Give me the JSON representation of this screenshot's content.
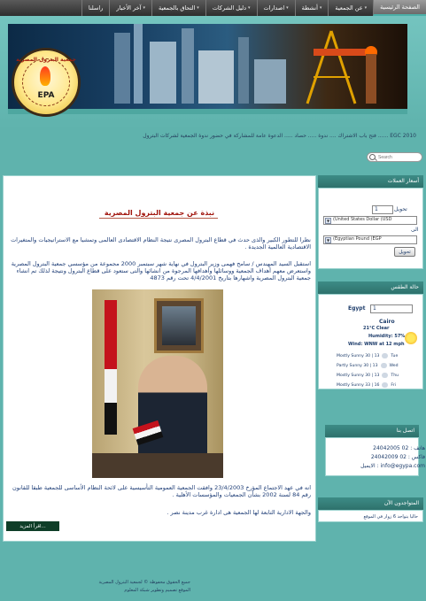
{
  "nav": {
    "items": [
      {
        "label": "الصفحة الرئيسية",
        "arrow": false,
        "active": true
      },
      {
        "label": "عن الجمعية",
        "arrow": true
      },
      {
        "label": "أنشطة",
        "arrow": true
      },
      {
        "label": "اصدارات",
        "arrow": true
      },
      {
        "label": "دليل الشركات",
        "arrow": true
      },
      {
        "label": "التحاق بالجمعية",
        "arrow": true
      },
      {
        "label": "آخر الأخبار",
        "arrow": true
      },
      {
        "label": "راسلنا",
        "arrow": false
      }
    ]
  },
  "header": {
    "logo_arc_text": "جمعية البترول المصرية",
    "logo_text": "EPA",
    "ticker": "EGC 2010 ...... فتح باب الاشتراك ....  ندوة ..... حصاد ..... الدعوة عامة للمشاركة في حضور ندوة الجمعية لشركات البترول"
  },
  "search": {
    "placeholder": "Search"
  },
  "article": {
    "title": "نبذة عن جمعية البترول المصرية",
    "para1": "نظرا للتطور الكبير والذى حدث في قطاع البترول المصرى نتيجة النظام الاقتصادى العالمى وتمشيا مع الاستراتيجيات والمتغيرات الاقتصادية العالمية الجديدة .",
    "para2": "استقبل السيد المهندس / سامح فهمى وزير البترول في نهاية شهر سبتمبر 2000 مجموعة من مؤسسي جمعية البترول المصرية واستعرض معهم أهداف الجمعية ووسائلها وأهدافها المرجوة من انشائها والتى ستعود على قطاع البترول ونتيجة لذلك تم انشاء جمعية البترول المصرية واشهارها بتاريخ 4/4/2001 تحت رقم 4873",
    "para3": "انه في عهد الاجتماع المؤرخ 23/4/2003 وافقت الجمعية العمومية التأسيسية على لائحة النظام الأساسى للجمعية طبقا للقانون رقم 84 لسنة 2002 بشأن الجمعيات والمؤسسات الأهلية .",
    "para4": "والجهة الادارية التابعة لها الجمعية هى ادارة غرب مدينة نصر .",
    "readmore": "اقرأ المزيد..."
  },
  "currency": {
    "header": "أسعار العملات",
    "amount_label": "تحويل",
    "amount_value": "1",
    "to_label": "الى",
    "from_currency": "(United States Dollar (USD",
    "to_currency": "(Egyptian Pound (EGP",
    "convert_button": "تحويل"
  },
  "weather": {
    "header": "حالة الطقس",
    "city_label": "Egypt",
    "city_value": "1",
    "city": "Cairo",
    "temp": "21°C  Clear",
    "humidity": "Humidity: 57%",
    "wind": "Wind: WNW at 12 mph",
    "forecast": [
      {
        "desc": "Mostly Sunny 30 | 13",
        "day": "Tue"
      },
      {
        "desc": "Partly Sunny 30 | 13",
        "day": "Wed"
      },
      {
        "desc": "Mostly Sunny 30 | 13",
        "day": "Thu"
      },
      {
        "desc": "Mostly Sunny 33 | 16",
        "day": "Fri"
      }
    ]
  },
  "contact": {
    "header": "اتصل بنا",
    "phone": "هاتف : 02 24042005",
    "fax": "فاكس : 02 24042009",
    "email": "info@egypa.com : الايميل"
  },
  "online": {
    "header": "المتواجدون الآن",
    "text": "حاليا يتواجد 6 زوار في الموقع"
  },
  "footer": {
    "line1": "جميع الحقوق محفوظة © لجمعية البترول المصرية",
    "line2": "الموقع تصميم وتطوير شبكة المعلوم"
  }
}
